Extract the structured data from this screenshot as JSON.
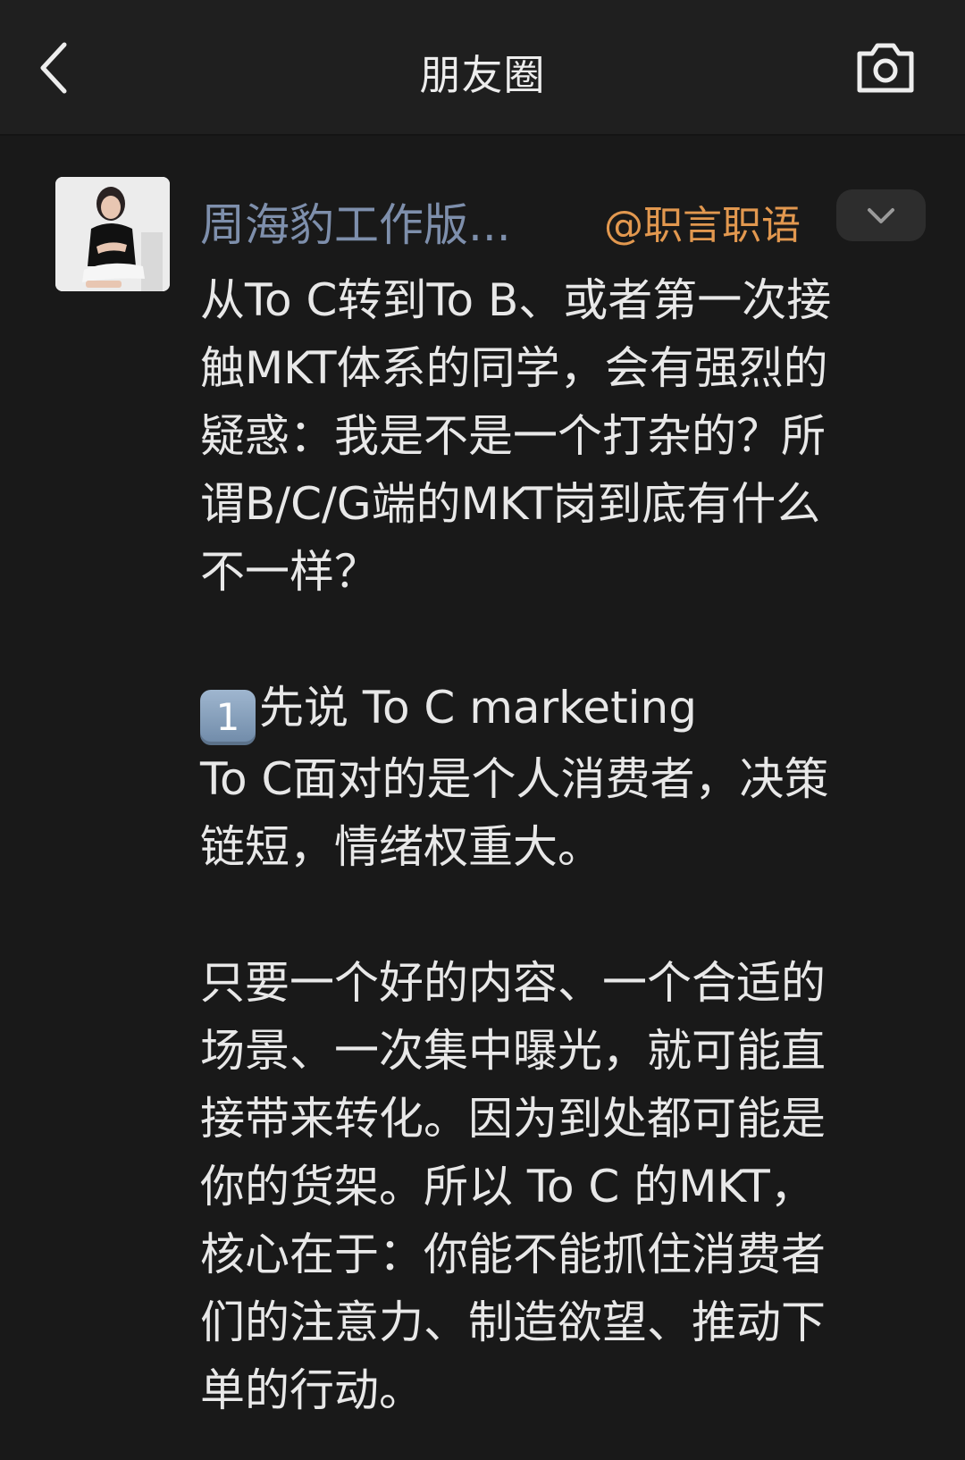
{
  "header": {
    "title": "朋友圈",
    "back_icon": "chevron-left-icon",
    "camera_icon": "camera-icon"
  },
  "post": {
    "author": "周海豹工作版...",
    "mention": "@职言职语",
    "expand_icon": "chevron-down-icon",
    "paragraphs": {
      "p1_lines": {
        "l1": "从To C转到To B、或者第一次接",
        "l2": "触MKT体系的同学，会有强烈的",
        "l3": "疑惑：我是不是一个打杂的？所",
        "l4": "谓B/C/G端的MKT岗到底有什么",
        "l5": "不一样？"
      },
      "p2": {
        "badge": "1",
        "heading": "先说 To C marketing",
        "l1": "To C面对的是个人消费者，决策",
        "l2": "链短，情绪权重大。"
      },
      "p3_lines": {
        "l1": "只要一个好的内容、一个合适的",
        "l2": "场景、一次集中曝光，就可能直",
        "l3": "接带来转化。因为到处都可能是",
        "l4": "你的货架。所以 To C 的MKT，",
        "l5": "核心在于：你能不能抓住消费者",
        "l6": "们的注意力、制造欲望、推动下",
        "l7": "单的行动。"
      }
    }
  },
  "colors": {
    "background": "#191919",
    "topbar": "#1f1f1f",
    "author": "#7e8fac",
    "mention": "#e2984f",
    "text": "#e8e8e8"
  }
}
